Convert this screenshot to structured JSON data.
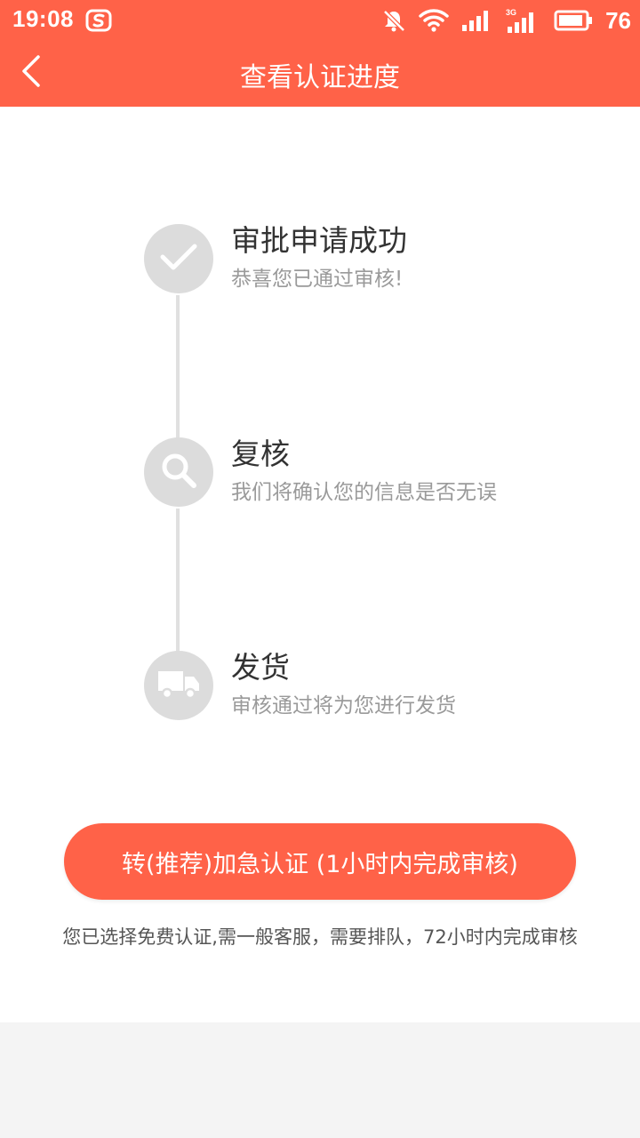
{
  "status_bar": {
    "time": "19:08",
    "battery": "76",
    "network_label": "3G",
    "icons": [
      "sogou-icon",
      "bell-muted-icon",
      "wifi-icon",
      "signal-icon",
      "signal-3g-icon",
      "battery-icon"
    ]
  },
  "nav": {
    "title": "查看认证进度",
    "back_icon": "chevron-left-icon"
  },
  "steps": [
    {
      "title": "审批申请成功",
      "desc": "恭喜您已通过审核!",
      "icon": "check-icon"
    },
    {
      "title": "复核",
      "desc": "我们将确认您的信息是否无误",
      "icon": "search-icon"
    },
    {
      "title": "发货",
      "desc": "审核通过将为您进行发货",
      "icon": "truck-icon"
    }
  ],
  "urgent_button": {
    "label": "转(推荐)加急认证 (1小时内完成审核)"
  },
  "notice": "您已选择免费认证,需一般客服，需要排队，72小时内完成审核",
  "colors": {
    "brand": "#ff6248",
    "step_circle": "#dcdcdc",
    "timeline": "#e0e0e0",
    "title_text": "#333333",
    "desc_text": "#9a9a9a"
  }
}
